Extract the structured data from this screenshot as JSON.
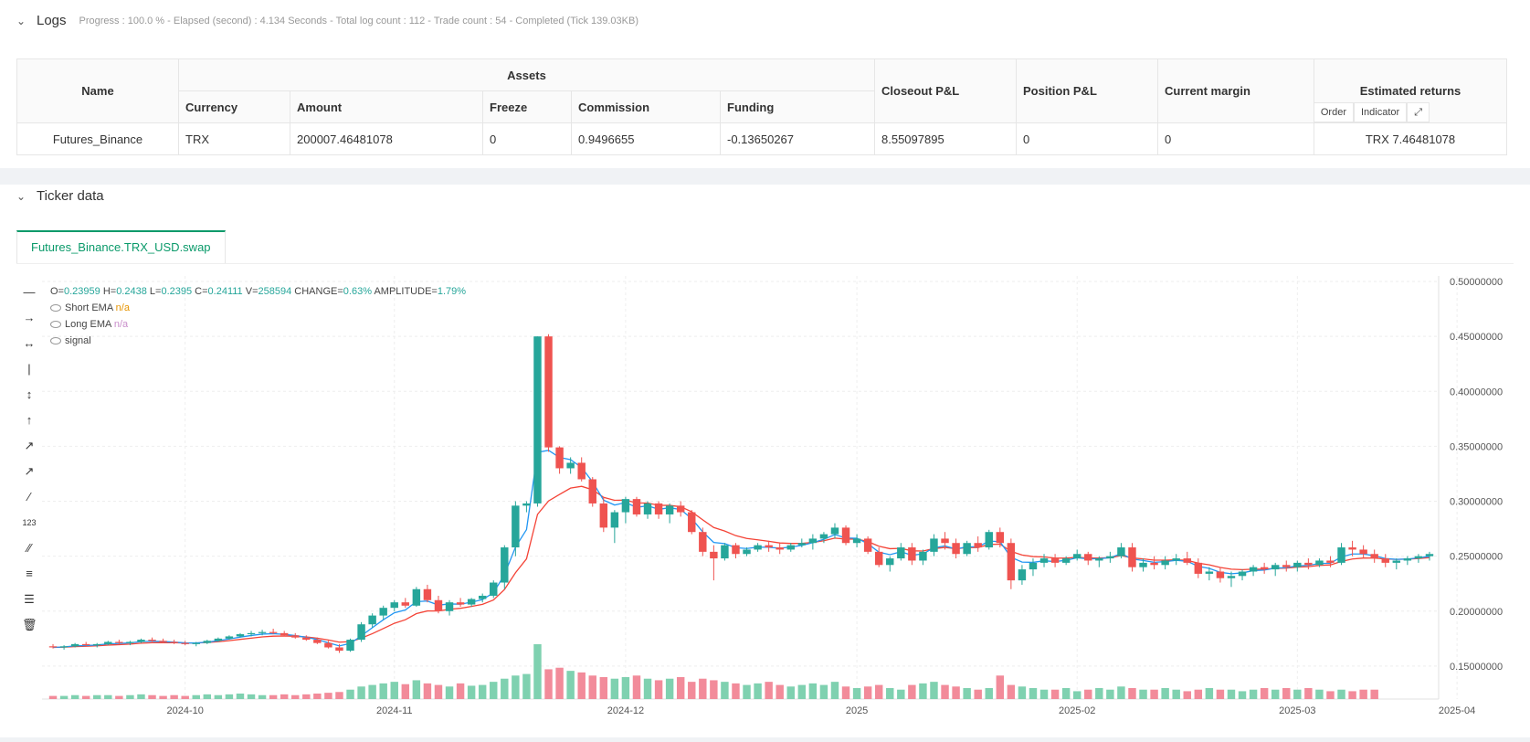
{
  "logs": {
    "title": "Logs",
    "meta": "Progress : 100.0 % - Elapsed (second) : 4.134 Seconds - Total log count : 112 - Trade count : 54 - Completed (Tick 139.03KB)"
  },
  "assets_table": {
    "headers": {
      "name": "Name",
      "assets": "Assets",
      "currency": "Currency",
      "amount": "Amount",
      "freeze": "Freeze",
      "commission": "Commission",
      "funding": "Funding",
      "closeout": "Closeout P&L",
      "position": "Position P&L",
      "margin": "Current margin",
      "returns": "Estimated returns"
    },
    "row": {
      "name": "Futures_Binance",
      "currency": "TRX",
      "amount": "200007.46481078",
      "freeze": "0",
      "commission": "0.9496655",
      "funding": "-0.13650267",
      "closeout": "8.55097895",
      "position": "0",
      "margin": "0",
      "returns": "TRX 7.46481078"
    }
  },
  "ticker": {
    "title": "Ticker data",
    "tab": "Futures_Binance.TRX_USD.swap",
    "buttons": {
      "order": "Order",
      "indicator": "Indicator"
    }
  },
  "ohlc": {
    "o_label": "O=",
    "o": "0.23959",
    "h_label": "H=",
    "h": "0.2438",
    "l_label": "L=",
    "l": "0.2395",
    "c_label": "C=",
    "c": "0.24111",
    "v_label": "V=",
    "v": "258594",
    "change_label": "CHANGE=",
    "change": "0.63%",
    "amp_label": "AMPLITUDE=",
    "amp": "1.79%"
  },
  "legend": [
    {
      "name": "Short EMA",
      "value": "n/a"
    },
    {
      "name": "Long EMA",
      "value": "n/a"
    },
    {
      "name": "signal",
      "value": ""
    }
  ],
  "toolbar_icons": [
    "horizontal-line-icon",
    "horizontal-ray-icon",
    "extended-line-icon",
    "vertical-line-icon",
    "vertical-segment-icon",
    "vertical-ray-icon",
    "trend-line-icon",
    "ray-icon",
    "segment-icon",
    "price-label-icon",
    "parallel-channel-icon",
    "pitchfork-icon",
    "fibonacci-icon",
    "trash-icon"
  ],
  "colors": {
    "up": "#26a69a",
    "down": "#ef5350",
    "short_ema": "#2196f3",
    "long_ema": "#f44336",
    "buy": "#2962ff",
    "sell": "#d500f9",
    "accent": "#0a9a6a"
  },
  "chart_data": {
    "type": "candlestick",
    "y_ticks": [
      "0.50000000",
      "0.45000000",
      "0.40000000",
      "0.35000000",
      "0.30000000",
      "0.25000000",
      "0.20000000",
      "0.15000000"
    ],
    "ylim": [
      0.12,
      0.505
    ],
    "x_ticks": [
      "2024-10",
      "2024-11",
      "2024-12",
      "2025",
      "2025-02",
      "2025-03",
      "2025-04"
    ],
    "grid": true,
    "candles": [
      [
        0.168,
        0.17,
        0.166,
        0.167
      ],
      [
        0.167,
        0.169,
        0.165,
        0.168
      ],
      [
        0.168,
        0.171,
        0.167,
        0.17
      ],
      [
        0.17,
        0.172,
        0.168,
        0.169
      ],
      [
        0.169,
        0.171,
        0.167,
        0.17
      ],
      [
        0.17,
        0.173,
        0.169,
        0.172
      ],
      [
        0.172,
        0.174,
        0.17,
        0.171
      ],
      [
        0.171,
        0.173,
        0.169,
        0.172
      ],
      [
        0.172,
        0.175,
        0.171,
        0.174
      ],
      [
        0.174,
        0.176,
        0.172,
        0.173
      ],
      [
        0.173,
        0.175,
        0.171,
        0.172
      ],
      [
        0.172,
        0.174,
        0.17,
        0.171
      ],
      [
        0.171,
        0.173,
        0.169,
        0.17
      ],
      [
        0.17,
        0.172,
        0.168,
        0.171
      ],
      [
        0.171,
        0.174,
        0.17,
        0.173
      ],
      [
        0.173,
        0.176,
        0.172,
        0.175
      ],
      [
        0.175,
        0.178,
        0.174,
        0.177
      ],
      [
        0.177,
        0.18,
        0.176,
        0.179
      ],
      [
        0.179,
        0.182,
        0.177,
        0.18
      ],
      [
        0.18,
        0.183,
        0.178,
        0.181
      ],
      [
        0.181,
        0.184,
        0.179,
        0.18
      ],
      [
        0.18,
        0.182,
        0.177,
        0.178
      ],
      [
        0.178,
        0.18,
        0.175,
        0.176
      ],
      [
        0.176,
        0.178,
        0.173,
        0.174
      ],
      [
        0.174,
        0.176,
        0.17,
        0.171
      ],
      [
        0.171,
        0.173,
        0.166,
        0.167
      ],
      [
        0.167,
        0.17,
        0.162,
        0.164
      ],
      [
        0.164,
        0.175,
        0.163,
        0.174
      ],
      [
        0.174,
        0.19,
        0.172,
        0.188
      ],
      [
        0.188,
        0.198,
        0.185,
        0.196
      ],
      [
        0.196,
        0.205,
        0.192,
        0.203
      ],
      [
        0.203,
        0.21,
        0.2,
        0.208
      ],
      [
        0.208,
        0.212,
        0.203,
        0.205
      ],
      [
        0.205,
        0.222,
        0.204,
        0.22
      ],
      [
        0.22,
        0.224,
        0.208,
        0.21
      ],
      [
        0.21,
        0.214,
        0.198,
        0.2
      ],
      [
        0.2,
        0.21,
        0.196,
        0.208
      ],
      [
        0.208,
        0.212,
        0.204,
        0.206
      ],
      [
        0.206,
        0.212,
        0.204,
        0.211
      ],
      [
        0.211,
        0.216,
        0.208,
        0.214
      ],
      [
        0.214,
        0.228,
        0.212,
        0.226
      ],
      [
        0.226,
        0.26,
        0.22,
        0.258
      ],
      [
        0.258,
        0.3,
        0.25,
        0.296
      ],
      [
        0.296,
        0.3,
        0.29,
        0.298
      ],
      [
        0.298,
        0.45,
        0.295,
        0.45
      ],
      [
        0.45,
        0.452,
        0.345,
        0.349
      ],
      [
        0.349,
        0.35,
        0.325,
        0.33
      ],
      [
        0.33,
        0.34,
        0.325,
        0.335
      ],
      [
        0.335,
        0.34,
        0.318,
        0.32
      ],
      [
        0.32,
        0.322,
        0.295,
        0.298
      ],
      [
        0.298,
        0.304,
        0.272,
        0.276
      ],
      [
        0.276,
        0.292,
        0.262,
        0.29
      ],
      [
        0.29,
        0.304,
        0.28,
        0.302
      ],
      [
        0.302,
        0.304,
        0.286,
        0.288
      ],
      [
        0.288,
        0.3,
        0.284,
        0.298
      ],
      [
        0.298,
        0.3,
        0.284,
        0.288
      ],
      [
        0.288,
        0.298,
        0.28,
        0.296
      ],
      [
        0.296,
        0.3,
        0.286,
        0.29
      ],
      [
        0.29,
        0.292,
        0.27,
        0.272
      ],
      [
        0.272,
        0.276,
        0.25,
        0.254
      ],
      [
        0.254,
        0.26,
        0.228,
        0.248
      ],
      [
        0.248,
        0.262,
        0.246,
        0.26
      ],
      [
        0.26,
        0.262,
        0.248,
        0.252
      ],
      [
        0.252,
        0.258,
        0.25,
        0.256
      ],
      [
        0.256,
        0.262,
        0.254,
        0.26
      ],
      [
        0.26,
        0.264,
        0.254,
        0.258
      ],
      [
        0.258,
        0.262,
        0.252,
        0.256
      ],
      [
        0.256,
        0.262,
        0.254,
        0.26
      ],
      [
        0.26,
        0.266,
        0.258,
        0.262
      ],
      [
        0.262,
        0.27,
        0.256,
        0.266
      ],
      [
        0.266,
        0.272,
        0.262,
        0.27
      ],
      [
        0.27,
        0.28,
        0.266,
        0.276
      ],
      [
        0.276,
        0.278,
        0.26,
        0.262
      ],
      [
        0.262,
        0.27,
        0.258,
        0.266
      ],
      [
        0.266,
        0.268,
        0.252,
        0.254
      ],
      [
        0.254,
        0.258,
        0.24,
        0.242
      ],
      [
        0.242,
        0.25,
        0.236,
        0.248
      ],
      [
        0.248,
        0.262,
        0.246,
        0.258
      ],
      [
        0.258,
        0.262,
        0.242,
        0.246
      ],
      [
        0.246,
        0.256,
        0.242,
        0.254
      ],
      [
        0.254,
        0.27,
        0.25,
        0.266
      ],
      [
        0.266,
        0.272,
        0.256,
        0.262
      ],
      [
        0.262,
        0.266,
        0.248,
        0.252
      ],
      [
        0.252,
        0.264,
        0.25,
        0.262
      ],
      [
        0.262,
        0.268,
        0.254,
        0.258
      ],
      [
        0.258,
        0.274,
        0.256,
        0.272
      ],
      [
        0.272,
        0.276,
        0.258,
        0.262
      ],
      [
        0.262,
        0.266,
        0.22,
        0.228
      ],
      [
        0.228,
        0.242,
        0.224,
        0.238
      ],
      [
        0.238,
        0.248,
        0.232,
        0.244
      ],
      [
        0.244,
        0.252,
        0.24,
        0.248
      ],
      [
        0.248,
        0.252,
        0.24,
        0.244
      ],
      [
        0.244,
        0.25,
        0.242,
        0.248
      ],
      [
        0.248,
        0.256,
        0.246,
        0.252
      ],
      [
        0.252,
        0.254,
        0.242,
        0.246
      ],
      [
        0.246,
        0.25,
        0.24,
        0.248
      ],
      [
        0.248,
        0.254,
        0.244,
        0.25
      ],
      [
        0.25,
        0.262,
        0.248,
        0.258
      ],
      [
        0.258,
        0.262,
        0.236,
        0.24
      ],
      [
        0.24,
        0.248,
        0.236,
        0.244
      ],
      [
        0.244,
        0.25,
        0.238,
        0.242
      ],
      [
        0.242,
        0.25,
        0.238,
        0.246
      ],
      [
        0.246,
        0.252,
        0.242,
        0.248
      ],
      [
        0.248,
        0.254,
        0.242,
        0.244
      ],
      [
        0.244,
        0.248,
        0.23,
        0.234
      ],
      [
        0.234,
        0.24,
        0.228,
        0.236
      ],
      [
        0.236,
        0.24,
        0.226,
        0.23
      ],
      [
        0.23,
        0.236,
        0.222,
        0.232
      ],
      [
        0.232,
        0.238,
        0.228,
        0.236
      ],
      [
        0.236,
        0.242,
        0.232,
        0.24
      ],
      [
        0.24,
        0.244,
        0.234,
        0.238
      ],
      [
        0.238,
        0.244,
        0.232,
        0.242
      ],
      [
        0.242,
        0.246,
        0.236,
        0.24
      ],
      [
        0.24,
        0.246,
        0.236,
        0.244
      ],
      [
        0.244,
        0.248,
        0.238,
        0.242
      ],
      [
        0.242,
        0.248,
        0.24,
        0.246
      ],
      [
        0.246,
        0.25,
        0.24,
        0.244
      ],
      [
        0.244,
        0.262,
        0.242,
        0.258
      ],
      [
        0.258,
        0.264,
        0.25,
        0.256
      ],
      [
        0.256,
        0.26,
        0.248,
        0.252
      ],
      [
        0.252,
        0.256,
        0.244,
        0.248
      ],
      [
        0.248,
        0.252,
        0.24,
        0.244
      ],
      [
        0.244,
        0.248,
        0.238,
        0.246
      ],
      [
        0.246,
        0.25,
        0.242,
        0.248
      ],
      [
        0.248,
        0.252,
        0.244,
        0.25
      ],
      [
        0.25,
        0.254,
        0.246,
        0.252
      ]
    ],
    "volumes": [
      4,
      4,
      5,
      4,
      5,
      5,
      4,
      5,
      6,
      5,
      4,
      5,
      4,
      5,
      6,
      5,
      6,
      7,
      6,
      5,
      5,
      6,
      5,
      6,
      7,
      8,
      9,
      12,
      16,
      18,
      20,
      22,
      19,
      24,
      20,
      18,
      16,
      20,
      17,
      18,
      22,
      26,
      30,
      32,
      70,
      38,
      40,
      36,
      34,
      30,
      28,
      26,
      28,
      30,
      26,
      24,
      26,
      28,
      22,
      26,
      24,
      22,
      20,
      18,
      20,
      22,
      18,
      16,
      18,
      20,
      18,
      22,
      16,
      14,
      16,
      18,
      14,
      12,
      18,
      20,
      22,
      18,
      16,
      14,
      12,
      14,
      30,
      18,
      16,
      14,
      12,
      12,
      14,
      10,
      12,
      14,
      12,
      16,
      14,
      12,
      12,
      14,
      12,
      10,
      12,
      14,
      12,
      12,
      10,
      12,
      14,
      12,
      14,
      12,
      14,
      12,
      10,
      12,
      10,
      12,
      12
    ]
  }
}
